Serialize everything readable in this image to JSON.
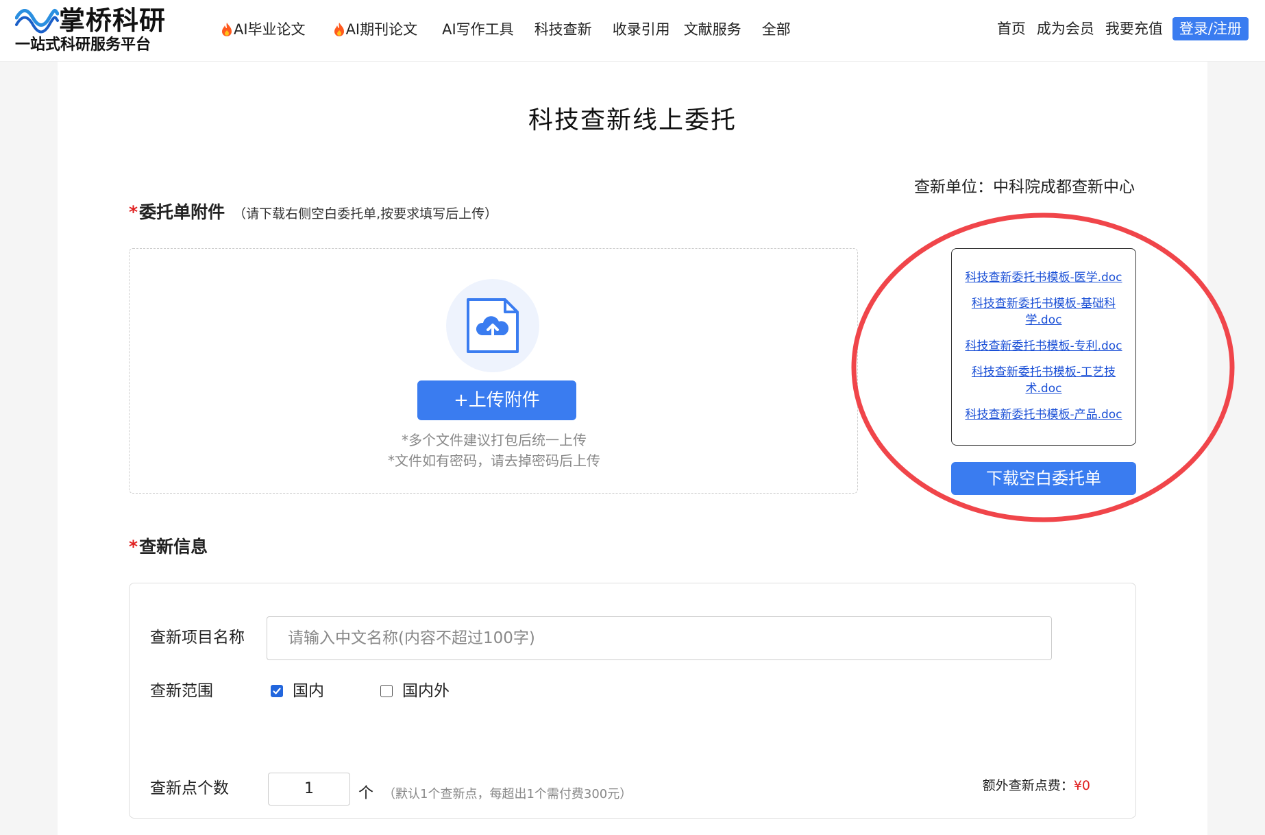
{
  "header": {
    "logo_title": "掌桥科研",
    "logo_subtitle": "一站式科研服务平台",
    "nav": [
      {
        "label": "AI毕业论文",
        "hot": true
      },
      {
        "label": "AI期刊论文",
        "hot": true
      },
      {
        "label": "AI写作工具",
        "hot": false
      },
      {
        "label": "科技查新",
        "hot": false
      },
      {
        "label": "收录引用",
        "hot": false
      },
      {
        "label": "文献服务",
        "hot": false
      },
      {
        "label": "全部",
        "hot": false
      }
    ],
    "right_links": [
      "首页",
      "成为会员",
      "我要充值"
    ],
    "login_label": "登录/注册"
  },
  "page": {
    "title": "科技查新线上委托",
    "unit_label": "查新单位：中科院成都查新中心"
  },
  "attachment": {
    "required_mark": "*",
    "title": "委托单附件",
    "note": "（请下载右侧空白委托单,按要求填写后上传）",
    "upload_label": "+上传附件",
    "tips": [
      "*多个文件建议打包后统一上传",
      "*文件如有密码，请去掉密码后上传"
    ]
  },
  "templates": {
    "links": [
      "科技查新委托书模板-医学.doc",
      "科技查新委托书模板-基础科学.doc",
      "科技查新委托书模板-专利.doc",
      "科技查新委托书模板-工艺技术.doc",
      "科技查新委托书模板-产品.doc"
    ],
    "download_label": "下载空白委托单"
  },
  "info": {
    "required_mark": "*",
    "title": "查新信息",
    "name_label": "查新项目名称",
    "name_placeholder": "请输入中文名称(内容不超过100字)",
    "scope_label": "查新范围",
    "scope_options": [
      {
        "label": "国内",
        "checked": true
      },
      {
        "label": "国内外",
        "checked": false
      }
    ],
    "count_label": "查新点个数",
    "count_value": "1",
    "count_unit": "个",
    "count_note": "（默认1个查新点，每超出1个需付费300元）",
    "fee_label": "额外查新点费：",
    "fee_value": "¥0"
  },
  "colors": {
    "primary": "#3a7cf0",
    "required": "#e02020",
    "link": "#1a4fd6",
    "annotation_circle": "#f0454a"
  }
}
